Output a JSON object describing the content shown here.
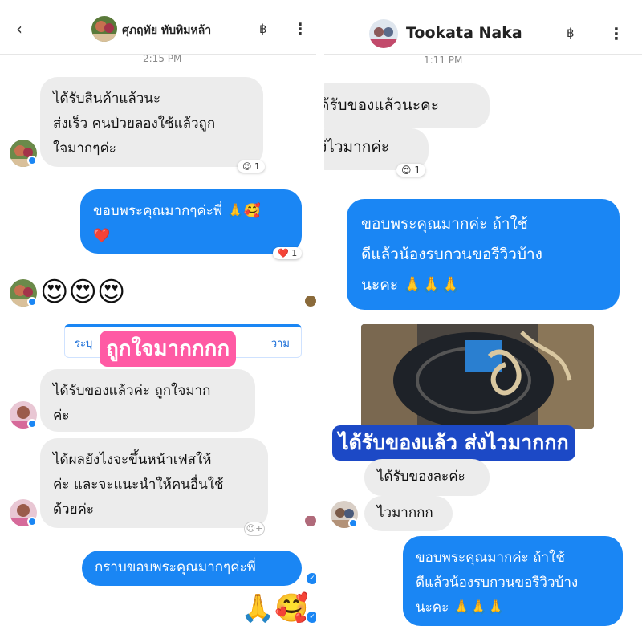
{
  "left": {
    "header": {
      "name": "ศุภฤทัย ทับทิมหล้า",
      "currency": "฿",
      "menu": "⋮",
      "back": "‹"
    },
    "timestamp": "2:15 PM",
    "msg1": {
      "text": "ได้รับสินค้าแล้วนะ\nส่งเร็ว คนป่วยลองใช้แล้วถูก\nใจมากๆค่ะ",
      "reaction": "😍 1"
    },
    "msg2": {
      "text": "ขอบพระคุณมากๆค่ะพี่ 🙏🥰\n❤️",
      "reaction": "❤️ 1"
    },
    "emojis": "😍😍😍",
    "suggestion": {
      "left": "ระบุ",
      "right": "วาม"
    },
    "overlay": "ถูกใจมากกกก",
    "msg3": {
      "text": "ได้รับของแล้วค่ะ ถูกใจมาก\nค่ะ"
    },
    "msg4": {
      "text": "ได้ผลยังไงจะขึ้นหน้าเฟสให้\nค่ะ และจะแนะนำให้คนอื่นใช้\nด้วยค่ะ"
    },
    "msg5": {
      "text": "กราบขอบพระคุณมากๆค่ะพี่"
    },
    "emojis_out": "🙏🥰"
  },
  "right": {
    "header": {
      "name": "Tookata Naka",
      "currency": "฿",
      "menu": "⋮"
    },
    "timestamp": "1:11 PM",
    "msg1": {
      "text": "ด้รับของแล้วนะคะ"
    },
    "msg2": {
      "text": "ง่ไวมากค่ะ",
      "reaction": "😍 1"
    },
    "msg3": {
      "text": "ขอบพระคุณมากค่ะ ถ้าใช้\nดีแล้วน้องรบกวนขอรีวิวบ้าง\nนะคะ 🙏🙏🙏"
    },
    "overlay": "ได้รับของแล้ว ส่งไวมากกก",
    "msg4": {
      "text": "ได้รับของละค่ะ"
    },
    "msg5": {
      "text": "ไวมากกก"
    },
    "msg6": {
      "text": "ขอบพระคุณมากค่ะ ถ้าใช้\nดีแล้วน้องรบกวนขอรีวิวบ้าง\nนะคะ 🙏🙏🙏"
    }
  }
}
